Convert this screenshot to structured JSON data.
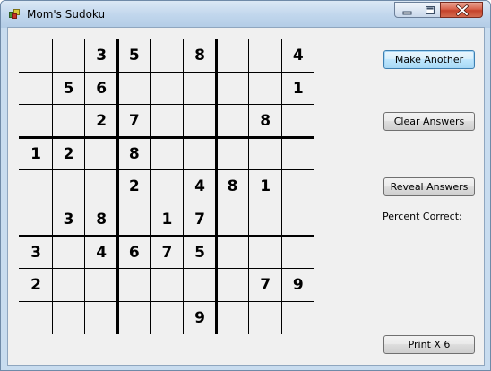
{
  "window": {
    "title": "Mom's Sudoku"
  },
  "grid": [
    [
      "",
      "",
      "3",
      "5",
      "",
      "8",
      "",
      "",
      "4"
    ],
    [
      "",
      "5",
      "6",
      "",
      "",
      "",
      "",
      "",
      "1"
    ],
    [
      "",
      "",
      "2",
      "7",
      "",
      "",
      "",
      "8",
      ""
    ],
    [
      "1",
      "2",
      "",
      "8",
      "",
      "",
      "",
      "",
      ""
    ],
    [
      "",
      "",
      "",
      "2",
      "",
      "4",
      "8",
      "1",
      ""
    ],
    [
      "",
      "3",
      "8",
      "",
      "1",
      "7",
      "",
      "",
      ""
    ],
    [
      "3",
      "",
      "4",
      "6",
      "7",
      "5",
      "",
      "",
      ""
    ],
    [
      "2",
      "",
      "",
      "",
      "",
      "",
      "",
      "7",
      "9"
    ],
    [
      "",
      "",
      "",
      "",
      "",
      "9",
      "",
      "",
      ""
    ]
  ],
  "buttons": {
    "make_another": "Make Another",
    "clear_answers": "Clear Answers",
    "reveal_answers": "Reveal Answers",
    "print": "Print X 6"
  },
  "labels": {
    "percent_correct": "Percent Correct:"
  },
  "colors": {
    "grid_line": "#000000",
    "background": "#f0f0f0"
  }
}
